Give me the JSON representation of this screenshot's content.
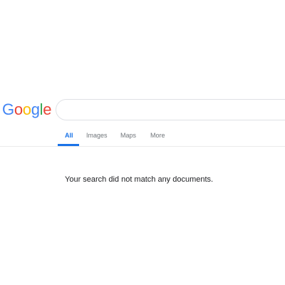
{
  "logo": {
    "text": "Google",
    "letters": [
      {
        "char": "G",
        "color": "#4285f4"
      },
      {
        "char": "o",
        "color": "#ea4335"
      },
      {
        "char": "o",
        "color": "#fbbc05"
      },
      {
        "char": "g",
        "color": "#4285f4"
      },
      {
        "char": "l",
        "color": "#34a853"
      },
      {
        "char": "e",
        "color": "#ea4335"
      }
    ]
  },
  "search": {
    "value": "",
    "placeholder": ""
  },
  "tabs": [
    {
      "label": "All",
      "active": true
    },
    {
      "label": "Images",
      "active": false
    },
    {
      "label": "Maps",
      "active": false
    },
    {
      "label": "More",
      "active": false
    }
  ],
  "results": {
    "message": "Your search did not match any documents."
  },
  "colors": {
    "accent": "#1a73e8",
    "tab_inactive": "#70757a",
    "text": "#202124",
    "border": "#dfe1e5"
  }
}
